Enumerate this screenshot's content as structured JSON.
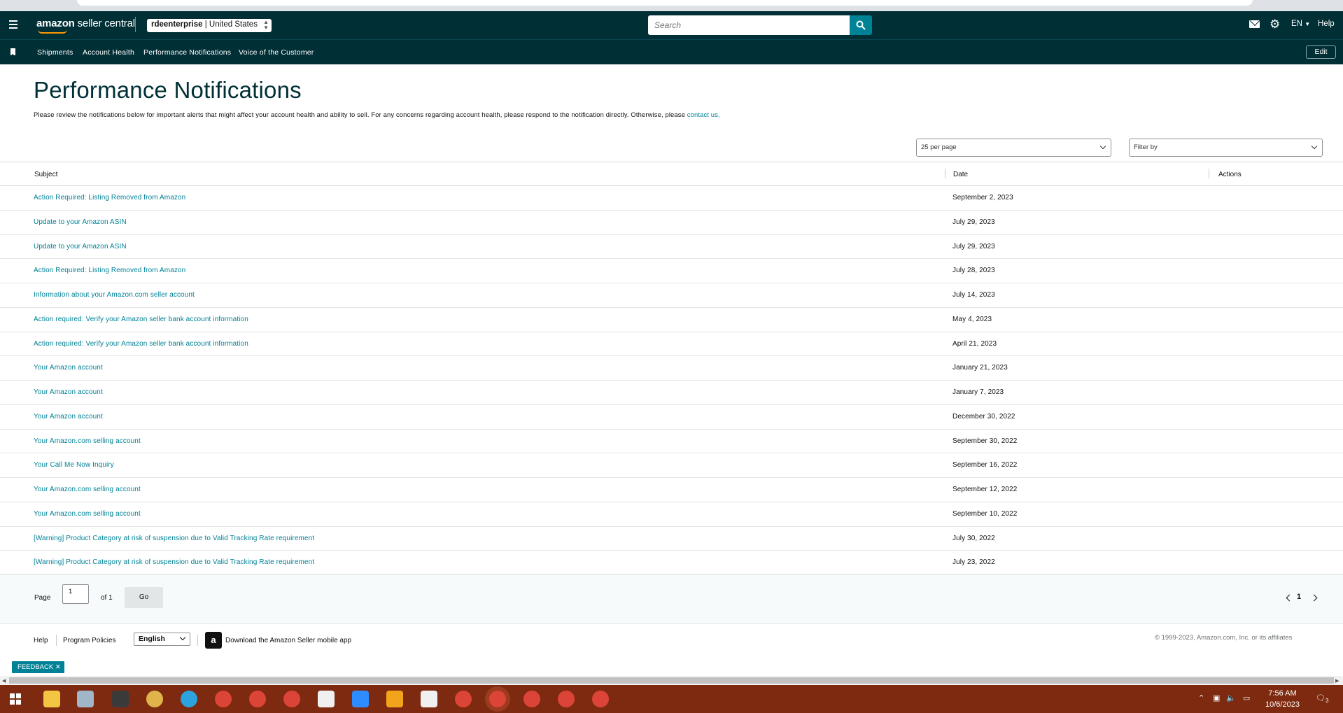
{
  "topnav": {
    "logo_main": "amazon",
    "logo_sub": "seller central",
    "store_name": "rdeenterprise",
    "store_marketplace": "| United States",
    "search_placeholder": "Search",
    "language": "EN",
    "help": "Help"
  },
  "subnav": {
    "items": [
      "Shipments",
      "Account Health",
      "Performance Notifications",
      "Voice of the Customer"
    ],
    "edit": "Edit"
  },
  "page": {
    "title": "Performance Notifications",
    "description": "Please review the notifications below for important alerts that might affect your account health and ability to sell. For any concerns regarding account health, please respond to the notification directly. Otherwise, please",
    "contact_link": "contact us."
  },
  "controls": {
    "per_page": "25 per page",
    "filter": "Filter by"
  },
  "table": {
    "headers": {
      "subject": "Subject",
      "date": "Date",
      "actions": "Actions"
    },
    "rows": [
      {
        "subject": "Action Required: Listing Removed from Amazon",
        "date": "September 2, 2023"
      },
      {
        "subject": "Update to your Amazon ASIN",
        "date": "July 29, 2023"
      },
      {
        "subject": "Update to your Amazon ASIN",
        "date": "July 29, 2023"
      },
      {
        "subject": "Action Required: Listing Removed from Amazon",
        "date": "July 28, 2023"
      },
      {
        "subject": "Information about your Amazon.com seller account",
        "date": "July 14, 2023"
      },
      {
        "subject": "Action required: Verify your Amazon seller bank account information",
        "date": "May 4, 2023"
      },
      {
        "subject": "Action required: Verify your Amazon seller bank account information",
        "date": "April 21, 2023"
      },
      {
        "subject": "Your Amazon account",
        "date": "January 21, 2023"
      },
      {
        "subject": "Your Amazon account",
        "date": "January 7, 2023"
      },
      {
        "subject": "Your Amazon account",
        "date": "December 30, 2022"
      },
      {
        "subject": "Your Amazon.com selling account",
        "date": "September 30, 2022"
      },
      {
        "subject": "Your Call Me Now Inquiry",
        "date": "September 16, 2022"
      },
      {
        "subject": "Your Amazon.com selling account",
        "date": "September 12, 2022"
      },
      {
        "subject": "Your Amazon.com selling account",
        "date": "September 10, 2022"
      },
      {
        "subject": "[Warning] Product Category at risk of suspension due to Valid Tracking Rate requirement",
        "date": "July 30, 2022"
      },
      {
        "subject": "[Warning] Product Category at risk of suspension due to Valid Tracking Rate requirement",
        "date": "July 23, 2022"
      }
    ]
  },
  "pagination": {
    "page_label": "Page",
    "page_value": "1",
    "of_label": "of 1",
    "go": "Go",
    "current": "1"
  },
  "footer": {
    "help": "Help",
    "program_policies": "Program Policies",
    "language": "English",
    "app_icon_glyph": "a",
    "download_app": "Download the Amazon Seller mobile app",
    "copyright": "© 1999-2023, Amazon.com, Inc. or its affiliates"
  },
  "feedback": "FEEDBACK ✕",
  "taskbar": {
    "time": "7:56 AM",
    "date": "10/6/2023",
    "notification_count": "3"
  },
  "colors": {
    "nav_bg": "#002f36",
    "link": "#008296",
    "taskbar_bg": "#7e2a10",
    "accent_orange": "#ff9900"
  }
}
